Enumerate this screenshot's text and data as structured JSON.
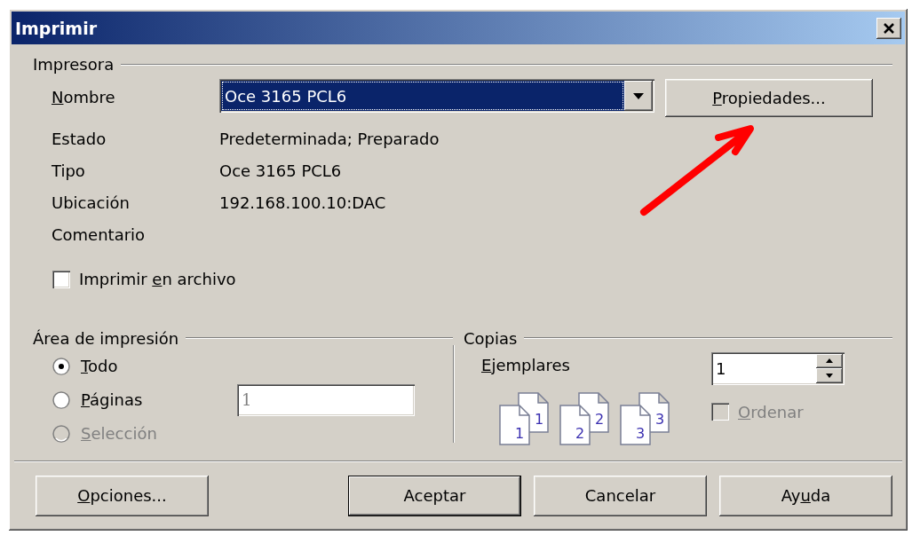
{
  "window": {
    "title": "Imprimir"
  },
  "printer": {
    "heading": "Impresora",
    "fields": [
      {
        "kind": "combo",
        "label": {
          "key": "N",
          "post": "ombre"
        },
        "value": "Oce 3165 PCL6",
        "focused": true
      },
      {
        "kind": "text",
        "label": "Estado",
        "value": "Predeterminada; Preparado"
      },
      {
        "kind": "text",
        "label": "Tipo",
        "value": "Oce 3165 PCL6"
      },
      {
        "kind": "text",
        "label": "Ubicación",
        "value": "192.168.100.10:DAC"
      },
      {
        "kind": "text",
        "label": "Comentario"
      }
    ],
    "properties_button": {
      "label": {
        "key": "P",
        "post": "ropiedades..."
      }
    },
    "print_to_file": {
      "label": {
        "pre": "Imprimir ",
        "key": "e",
        "post": "n archivo"
      },
      "checked": false,
      "disabled": false
    }
  },
  "print_range": {
    "heading": "Área de impresión",
    "options": [
      {
        "label": {
          "key": "T",
          "post": "odo"
        },
        "selected": true,
        "disabled": false
      },
      {
        "label": {
          "key": "P",
          "post": "áginas"
        },
        "selected": false,
        "disabled": false
      },
      {
        "label": {
          "key": "S",
          "post": "elección"
        },
        "selected": false,
        "disabled": true
      }
    ],
    "pages_field": {
      "value": "1",
      "disabled": true
    }
  },
  "copies": {
    "heading": "Copias",
    "count_label": {
      "key": "E",
      "post": "jemplares"
    },
    "count": "1",
    "collate_stacks": [
      {
        "front": "1",
        "back": "1"
      },
      {
        "front": "2",
        "back": "2"
      },
      {
        "front": "3",
        "back": "3"
      }
    ],
    "collate": {
      "label": {
        "key": "O",
        "post": "rdenar"
      },
      "checked": false,
      "disabled": true
    }
  },
  "buttons": [
    {
      "label": {
        "key": "O",
        "post": "pciones..."
      },
      "default": false
    },
    {
      "label": "Aceptar",
      "default": true
    },
    {
      "label": "Cancelar",
      "default": false
    },
    {
      "label": {
        "pre": "Ay",
        "key": "u",
        "post": "da"
      },
      "default": false
    }
  ],
  "annotation": {
    "kind": "arrow"
  }
}
